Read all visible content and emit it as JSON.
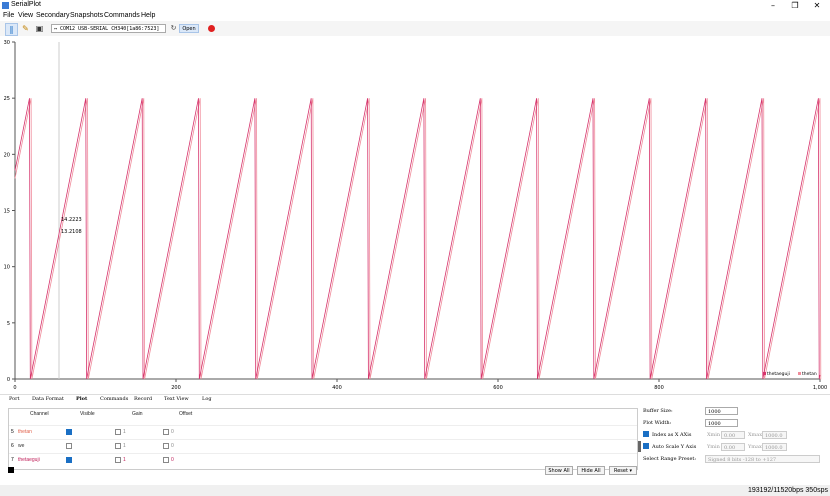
{
  "window": {
    "title": "SerialPlot"
  },
  "menu": [
    "File",
    "View",
    "Secondary",
    "Snapshots",
    "Commands",
    "Help"
  ],
  "toolbar": {
    "port": "↔ COM12 USB-SERIAL CH340[1a86:7523]",
    "refresh": "↻",
    "open_label": "Open"
  },
  "plot": {
    "y_ticks": [
      "30",
      "25",
      "20",
      "15",
      "10",
      "5",
      "0"
    ],
    "x_ticks": [
      "0",
      "200",
      "400",
      "600",
      "800",
      "1,000"
    ],
    "cursor_labels": [
      "14.2223",
      "13.2108"
    ],
    "legend": [
      "thetaeguji",
      "thetan"
    ],
    "colors": {
      "thetaeguji": "#d6336c",
      "thetan": "#f08c9b"
    }
  },
  "chart_data": {
    "type": "line",
    "xlim": [
      0,
      1000
    ],
    "ylim": [
      0,
      30
    ],
    "series": [
      {
        "name": "thetaeguji",
        "period": 70,
        "min": 0,
        "max": 25
      },
      {
        "name": "thetan",
        "period": 70,
        "min": 0,
        "max": 25
      }
    ]
  },
  "tabs": [
    "Port",
    "Data Format",
    "Plot",
    "Commands",
    "Record",
    "Text View",
    "Log"
  ],
  "channels": {
    "headers": [
      "Channel",
      "Visible",
      "Gain",
      "Offset"
    ],
    "rows": [
      {
        "index": "5",
        "name": "thetan",
        "visible": true,
        "gain": "1",
        "offset": "0",
        "color": "#e0604a"
      },
      {
        "index": "6",
        "name": "we",
        "visible": false,
        "gain": "1",
        "offset": "0",
        "color": "#333333"
      },
      {
        "index": "7",
        "name": "thetaeguji",
        "visible": true,
        "gain": "1",
        "offset": "0",
        "color": "#c0205a"
      }
    ]
  },
  "buttons": {
    "show_all": "Show All",
    "hide_all": "Hide All",
    "reset": "Reset ▾"
  },
  "settings": {
    "buffer_label": "Buffer Size:",
    "buffer_value": "1000",
    "width_label": "Plot Width:",
    "width_value": "1000",
    "index_label": "Index as X AXis",
    "xmin_label": "Xmin",
    "xmin_value": "0.00",
    "xmax_label": "Xmax",
    "xmax_value": "1000.0",
    "autoscale_label": "Auto Scale Y Axis",
    "ymin_label": "Ymin",
    "ymin_value": "0.00",
    "ymax_label": "Ymax",
    "ymax_value": "1000.0",
    "range_label": "Select Range Preset:",
    "range_value": "Signed 8 bits -128 to +127"
  },
  "status": {
    "text": "193192/11520bps  350sps"
  }
}
